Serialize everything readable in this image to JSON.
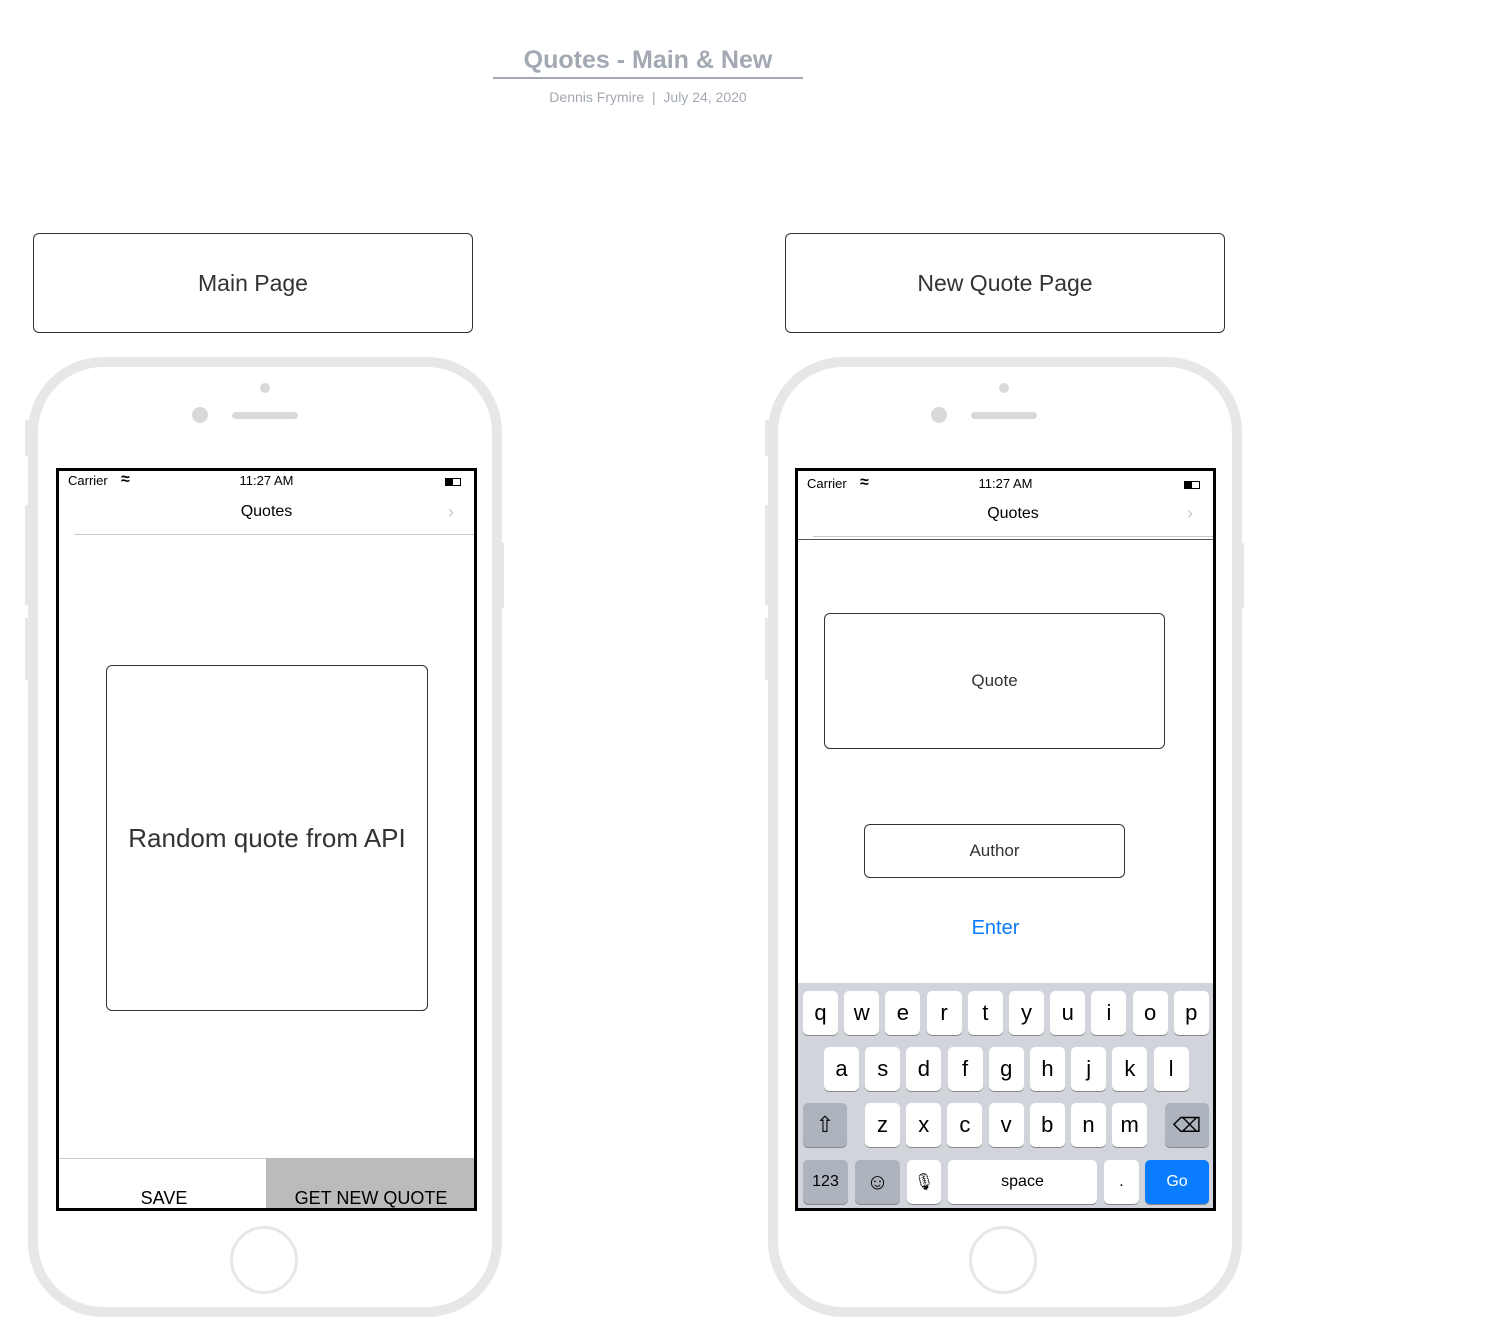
{
  "header": {
    "title": "Quotes - Main & New",
    "author": "Dennis Frymire",
    "separator": "|",
    "date": "July 24, 2020"
  },
  "main_page": {
    "label": "Main Page",
    "status": {
      "carrier": "Carrier",
      "time": "11:27 AM"
    },
    "nav_title": "Quotes",
    "nav_chevron": "›",
    "quote_text": "Random quote from API",
    "save_label": "SAVE",
    "get_new_label": "GET NEW QUOTE"
  },
  "new_page": {
    "label": "New Quote Page",
    "status": {
      "carrier": "Carrier",
      "time": "11:27 AM"
    },
    "nav_title": "Quotes",
    "nav_chevron": "›",
    "quote_placeholder": "Quote",
    "author_placeholder": "Author",
    "enter_label": "Enter"
  },
  "keyboard": {
    "row1": [
      "q",
      "w",
      "e",
      "r",
      "t",
      "y",
      "u",
      "i",
      "o",
      "p"
    ],
    "row2": [
      "a",
      "s",
      "d",
      "f",
      "g",
      "h",
      "j",
      "k",
      "l"
    ],
    "row3": [
      "z",
      "x",
      "c",
      "v",
      "b",
      "n",
      "m"
    ],
    "shift": "⇧",
    "delete": "⌫",
    "numbers": "123",
    "emoji": "☺",
    "mic": "🎙",
    "space": "space",
    "period": ".",
    "go": "Go"
  },
  "colors": {
    "accent": "#0a7cff",
    "keyboard_bg": "#d1d4da",
    "button_gray": "#bbbbbb"
  }
}
